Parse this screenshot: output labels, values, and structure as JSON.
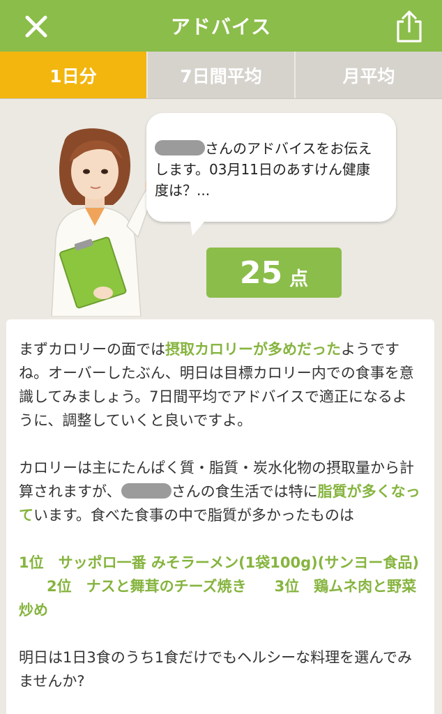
{
  "header": {
    "title": "アドバイス"
  },
  "tabs": [
    {
      "label": "1日分",
      "active": true
    },
    {
      "label": "7日間平均",
      "active": false
    },
    {
      "label": "月平均",
      "active": false
    }
  ],
  "bubble": {
    "text_after_name": "さんのアドバイスをお伝えします。03月11日のあすけん健康度は？..."
  },
  "score": {
    "value": "25",
    "unit": "点"
  },
  "advice": {
    "p1_a": "まずカロリーの面では",
    "p1_hl": "摂取カロリーが多めだった",
    "p1_b": "ようですね。オーバーしたぶん、明日は目標カロリー内での食事を意識してみましょう。7日間平均でアドバイスで適正になるように、調整していくと良いですよ。",
    "p2_a": "カロリーは主にたんぱく質・脂質・炭水化物の摂取量から計算されますが、",
    "p2_b": "さんの食生活では特に",
    "p2_hl": "脂質が多くなって",
    "p2_c": "います。食べた食事の中で脂質が多かったものは",
    "rank1": "1位　サッポロ一番 みそラーメン(1袋100g)(サンヨー食品)",
    "rank2": "2位　ナスと舞茸のチーズ焼き",
    "rank3": "3位　鶏ムネ肉と野菜炒め",
    "p3": "明日は1日3食のうち1食だけでもヘルシーな料理を選んでみませんか?"
  },
  "colors": {
    "header_green": "#8bbd4a",
    "tab_active": "#f3b60f",
    "tab_inactive": "#d6d3cd",
    "highlight_green": "#86b43f",
    "background": "#ebe9e2"
  },
  "icons": [
    "close-icon",
    "share-icon",
    "advisor-avatar"
  ]
}
